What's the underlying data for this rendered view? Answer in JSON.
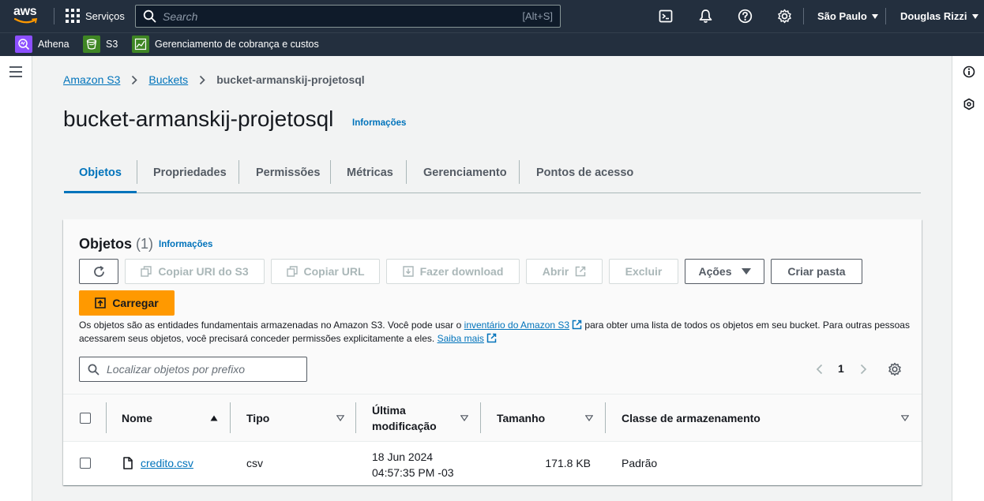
{
  "topnav": {
    "logo_text": "aws",
    "services_label": "Serviços",
    "search_placeholder": "Search",
    "search_shortcut": "[Alt+S]",
    "region": "São Paulo",
    "user": "Douglas Rizzi"
  },
  "favorites": [
    {
      "label": "Athena",
      "color": "#8c4fff"
    },
    {
      "label": "S3",
      "color": "#3f8624"
    },
    {
      "label": "Gerenciamento de cobrança e custos",
      "color": "#3f8624"
    }
  ],
  "breadcrumb": {
    "items": [
      "Amazon S3",
      "Buckets"
    ],
    "current": "bucket-armanskij-projetosql"
  },
  "page": {
    "title": "bucket-armanskij-projetosql",
    "info": "Informações"
  },
  "tabs": [
    "Objetos",
    "Propriedades",
    "Permissões",
    "Métricas",
    "Gerenciamento",
    "Pontos de acesso"
  ],
  "objects": {
    "title": "Objetos",
    "count": "(1)",
    "info": "Informações",
    "buttons": {
      "copy_uri": "Copiar URI do S3",
      "copy_url": "Copiar URL",
      "download": "Fazer download",
      "open": "Abrir",
      "delete": "Excluir",
      "actions": "Ações",
      "create_folder": "Criar pasta",
      "upload": "Carregar"
    },
    "desc_1": "Os objetos são as entidades fundamentais armazenadas no Amazon S3. Você pode usar o ",
    "desc_link_1": "inventário do Amazon S3",
    "desc_2": " para obter uma lista de todos os objetos em seu bucket. Para outras pessoas acessarem seus objetos, você precisará conceder permissões explicitamente a eles. ",
    "desc_link_2": "Saiba mais",
    "filter_placeholder": "Localizar objetos por prefixo",
    "page": "1",
    "columns": {
      "name": "Nome",
      "type": "Tipo",
      "modified_1": "Última",
      "modified_2": "modificação",
      "size": "Tamanho",
      "storage_class": "Classe de armazenamento"
    },
    "rows": [
      {
        "name": "credito.csv",
        "type": "csv",
        "date": "18 Jun 2024",
        "time": "04:57:35 PM -03",
        "size": "171.8 KB",
        "storage_class": "Padrão"
      }
    ]
  },
  "colors": {
    "accent": "#0073bb",
    "primary_button": "#ff9900",
    "topbar": "#232f3e"
  }
}
